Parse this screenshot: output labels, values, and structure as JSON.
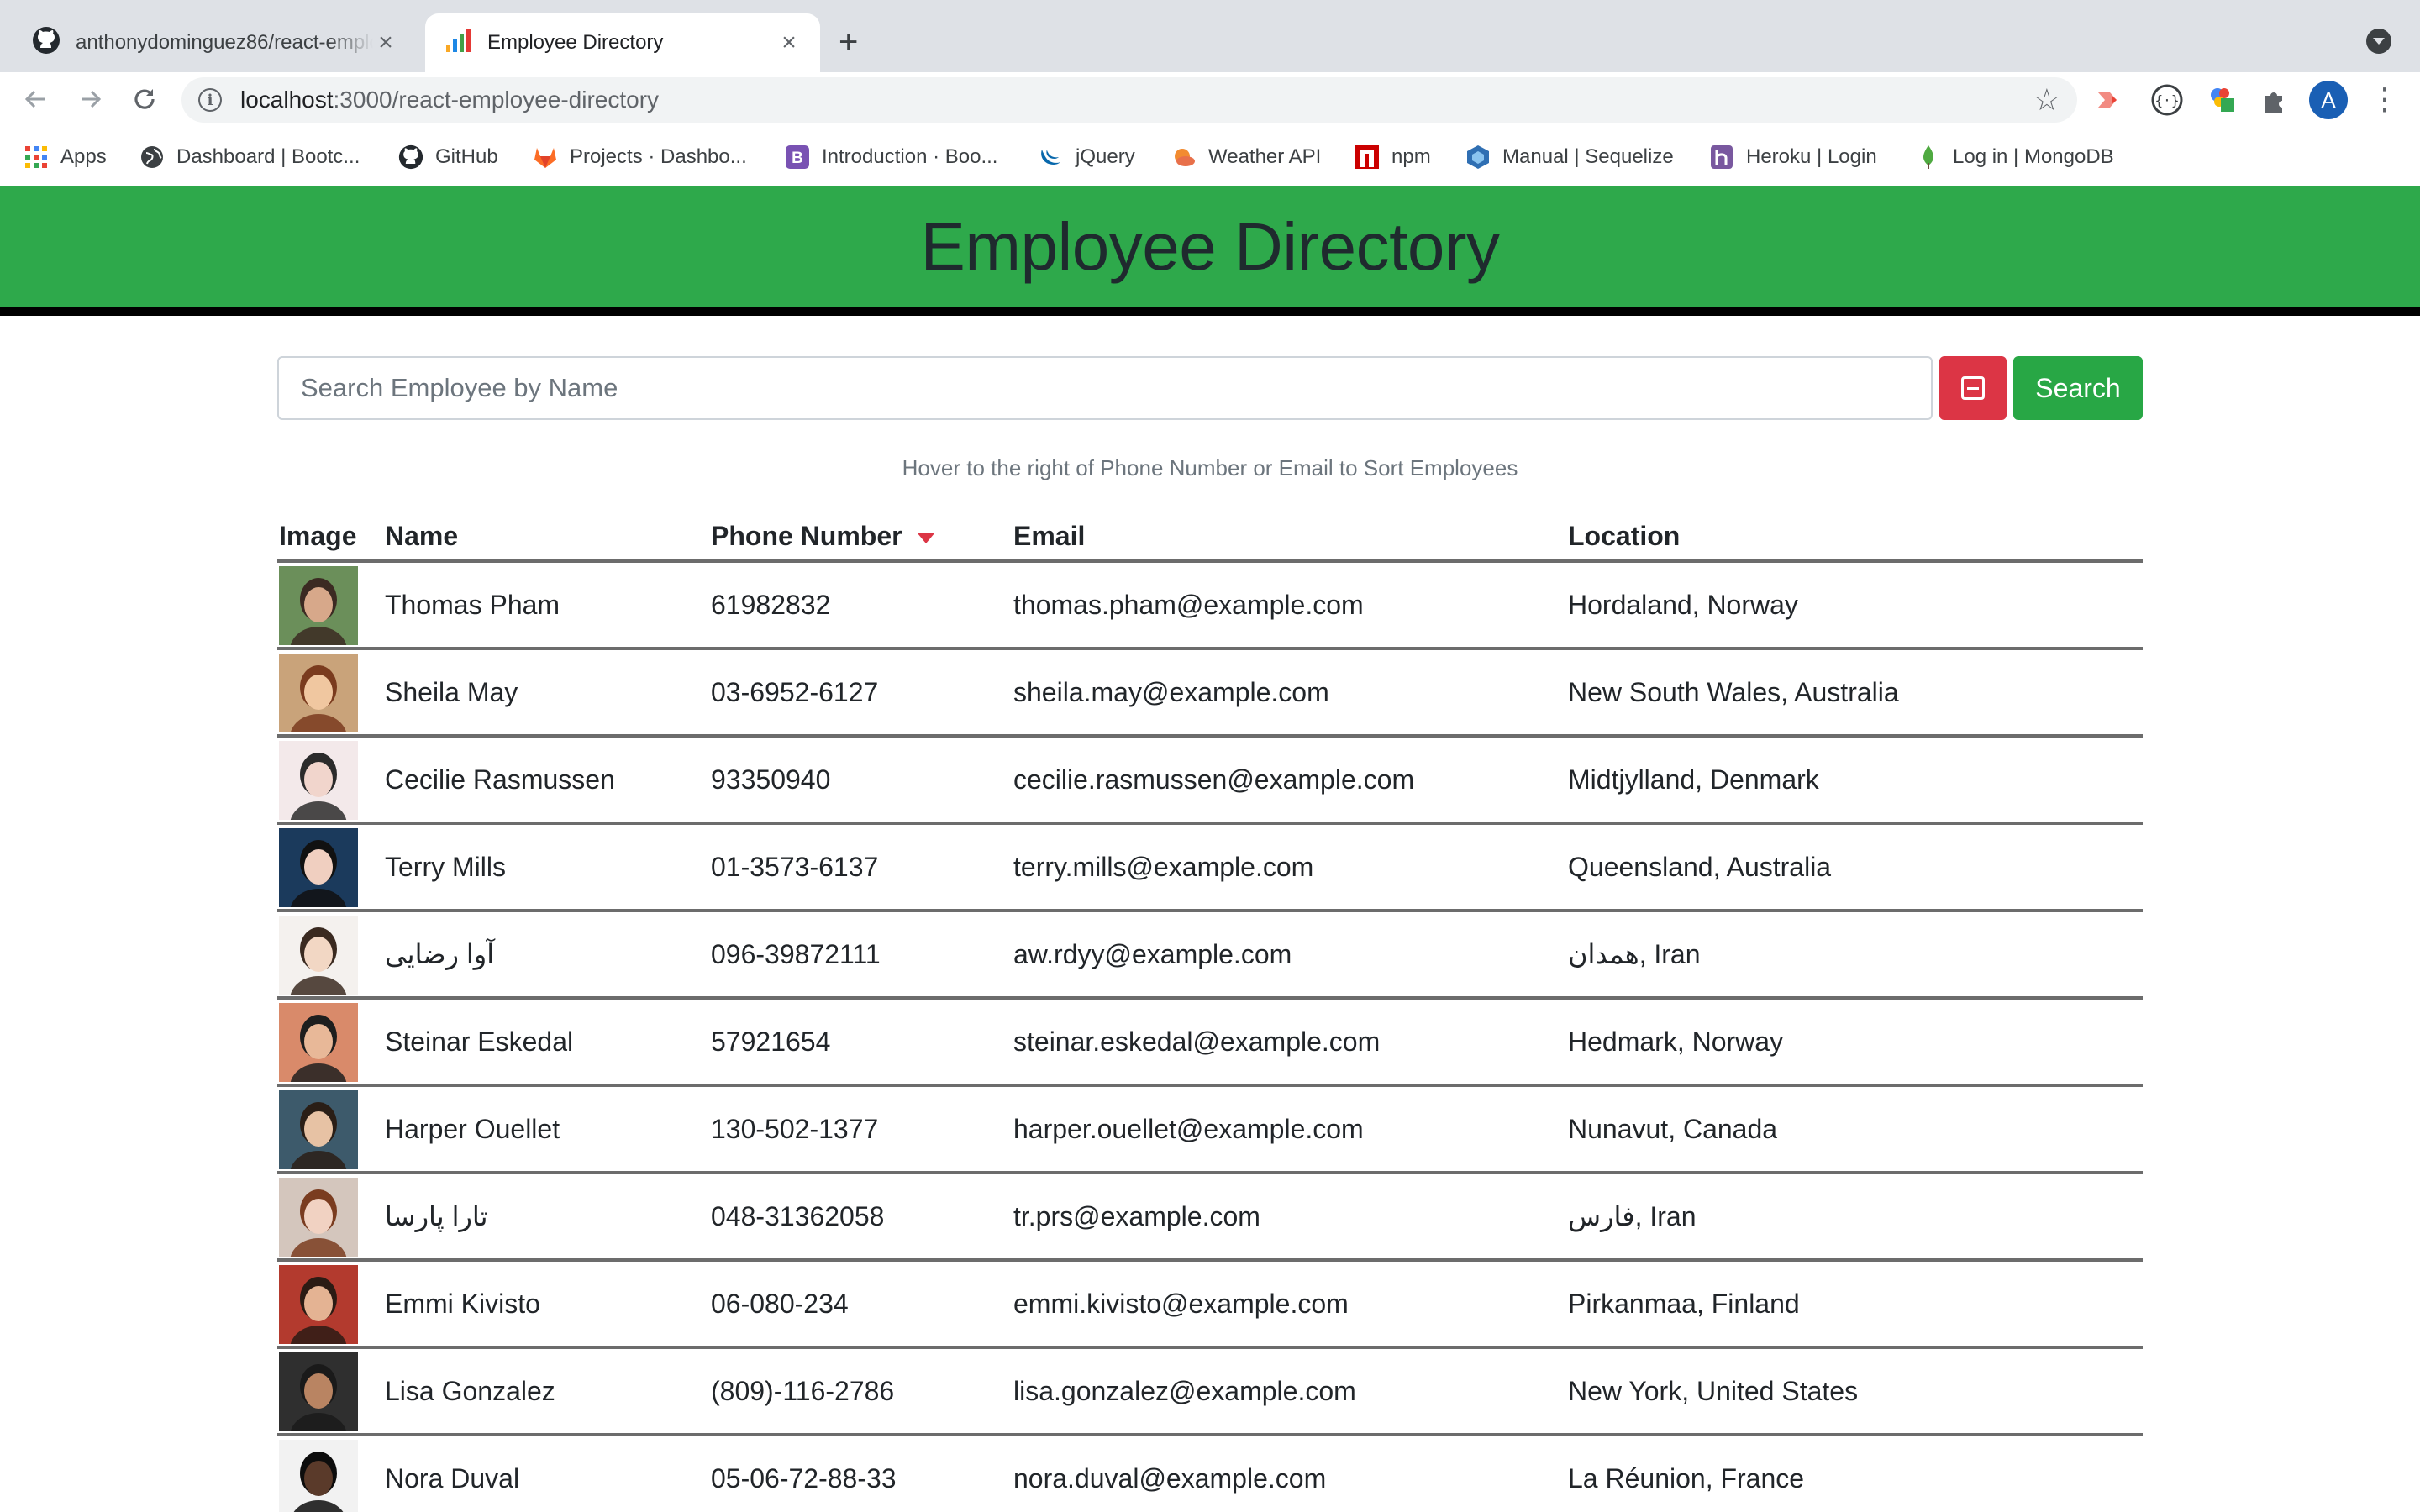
{
  "browser": {
    "tabs": [
      {
        "title": "anthonydominguez86/react-employee-directory",
        "icon": "github-icon",
        "active": false
      },
      {
        "title": "Employee Directory",
        "icon": "react-app-icon",
        "active": true
      }
    ],
    "url_host": "localhost",
    "url_path": ":3000/react-employee-directory",
    "profile_initial": "A",
    "bookmarks": [
      {
        "label": "Apps",
        "icon": "apps-grid-icon"
      },
      {
        "label": "Dashboard | Bootc...",
        "icon": "globe-icon"
      },
      {
        "label": "GitHub",
        "icon": "github-icon"
      },
      {
        "label": "Projects · Dashbo...",
        "icon": "gitlab-icon"
      },
      {
        "label": "Introduction · Boo...",
        "icon": "bootstrap-icon"
      },
      {
        "label": "jQuery",
        "icon": "jquery-icon"
      },
      {
        "label": "Weather API",
        "icon": "weather-icon"
      },
      {
        "label": "npm",
        "icon": "npm-icon"
      },
      {
        "label": "Manual | Sequelize",
        "icon": "sequelize-icon"
      },
      {
        "label": "Heroku | Login",
        "icon": "heroku-icon"
      },
      {
        "label": "Log in | MongoDB",
        "icon": "mongodb-icon"
      }
    ]
  },
  "page": {
    "title": "Employee Directory",
    "search": {
      "placeholder": "Search Employee by Name",
      "value": "",
      "button_label": "Search"
    },
    "hint": "Hover to the right of Phone Number or Email to Sort Employees",
    "columns": {
      "image": "Image",
      "name": "Name",
      "phone": "Phone Number",
      "email": "Email",
      "location": "Location"
    },
    "sort": {
      "column": "phone",
      "direction": "descending"
    },
    "colors": {
      "header_bg": "#2ea94b",
      "danger": "#dc3545",
      "success": "#28a745"
    },
    "employees": [
      {
        "name": "Thomas Pham",
        "phone": "61982832",
        "email": "thomas.pham@example.com",
        "location": "Hordaland, Norway"
      },
      {
        "name": "Sheila May",
        "phone": "03-6952-6127",
        "email": "sheila.may@example.com",
        "location": "New South Wales, Australia"
      },
      {
        "name": "Cecilie Rasmussen",
        "phone": "93350940",
        "email": "cecilie.rasmussen@example.com",
        "location": "Midtjylland, Denmark"
      },
      {
        "name": "Terry Mills",
        "phone": "01-3573-6137",
        "email": "terry.mills@example.com",
        "location": "Queensland, Australia"
      },
      {
        "name": "آوا رضایی",
        "phone": "096-39872111",
        "email": "aw.rdyy@example.com",
        "location": "همدان, Iran"
      },
      {
        "name": "Steinar Eskedal",
        "phone": "57921654",
        "email": "steinar.eskedal@example.com",
        "location": "Hedmark, Norway"
      },
      {
        "name": "Harper Ouellet",
        "phone": "130-502-1377",
        "email": "harper.ouellet@example.com",
        "location": "Nunavut, Canada"
      },
      {
        "name": "تارا پارسا",
        "phone": "048-31362058",
        "email": "tr.prs@example.com",
        "location": "فارس, Iran"
      },
      {
        "name": "Emmi Kivisto",
        "phone": "06-080-234",
        "email": "emmi.kivisto@example.com",
        "location": "Pirkanmaa, Finland"
      },
      {
        "name": "Lisa Gonzalez",
        "phone": "(809)-116-2786",
        "email": "lisa.gonzalez@example.com",
        "location": "New York, United States"
      },
      {
        "name": "Nora Duval",
        "phone": "05-06-72-88-33",
        "email": "nora.duval@example.com",
        "location": "La Réunion, France"
      }
    ]
  }
}
